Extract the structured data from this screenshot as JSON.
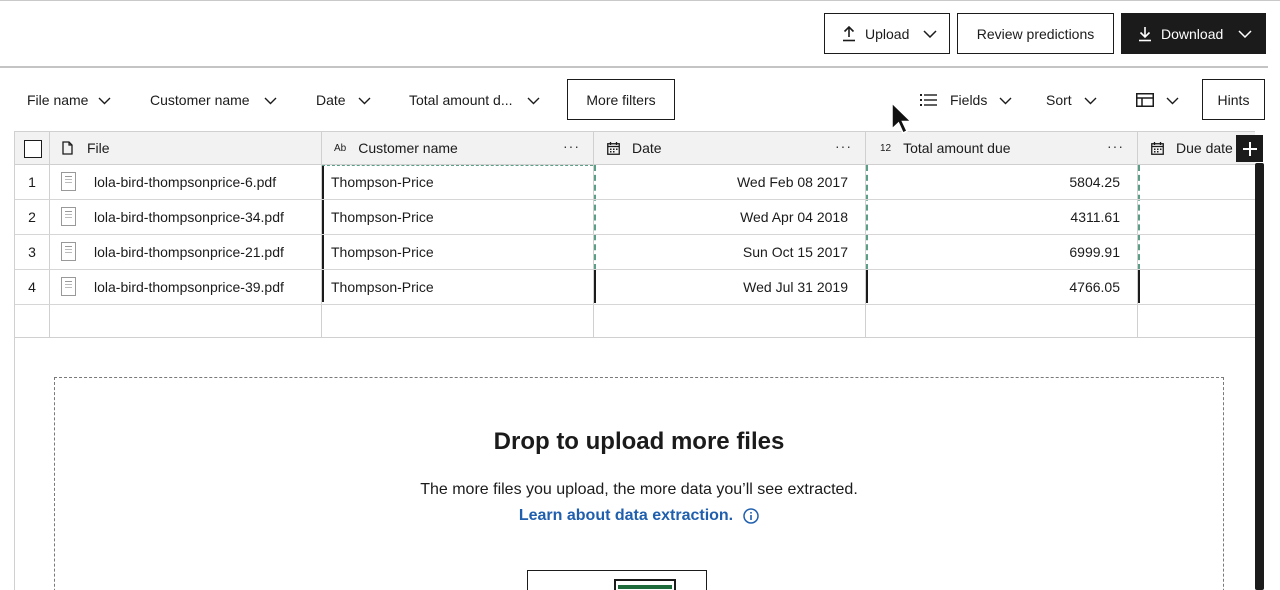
{
  "toolbar": {
    "upload_label": "Upload",
    "review_label": "Review predictions",
    "download_label": "Download"
  },
  "filters": {
    "file_name": "File name",
    "customer_name": "Customer name",
    "date": "Date",
    "total_amount": "Total amount d...",
    "more_filters": "More filters",
    "fields": "Fields",
    "sort": "Sort",
    "hints": "Hints"
  },
  "table": {
    "columns": {
      "file": "File",
      "customer": "Customer name",
      "date": "Date",
      "total": "Total amount due",
      "due": "Due date"
    },
    "type_icons": {
      "customer": "Ab",
      "total": "12"
    },
    "rows": [
      {
        "index": "1",
        "file": "lola-bird-thompsonprice-6.pdf",
        "customer": "Thompson-Price",
        "date": "Wed Feb 08 2017",
        "total": "5804.25"
      },
      {
        "index": "2",
        "file": "lola-bird-thompsonprice-34.pdf",
        "customer": "Thompson-Price",
        "date": "Wed Apr 04 2018",
        "total": "4311.61"
      },
      {
        "index": "3",
        "file": "lola-bird-thompsonprice-21.pdf",
        "customer": "Thompson-Price",
        "date": "Sun Oct 15 2017",
        "total": "6999.91"
      },
      {
        "index": "4",
        "file": "lola-bird-thompsonprice-39.pdf",
        "customer": "Thompson-Price",
        "date": "Wed Jul 31 2019",
        "total": "4766.05"
      }
    ],
    "menu_dots": "···"
  },
  "dropzone": {
    "title": "Drop to upload more files",
    "text": "The more files you upload, the more data you’ll see extracted.",
    "link": "Learn about data extraction."
  },
  "colors": {
    "dark": "#1b1b1b",
    "link": "#1f5fae",
    "header_bg": "#f2f2f2",
    "accent_green": "#1d6b3a"
  },
  "icons": [
    "upload-icon",
    "chevron-down-icon",
    "download-icon",
    "list-icon",
    "table-view-icon",
    "checkbox-icon",
    "file-icon",
    "text-type-icon",
    "calendar-icon",
    "number-type-icon",
    "info-icon",
    "plus-icon",
    "cursor-icon"
  ]
}
